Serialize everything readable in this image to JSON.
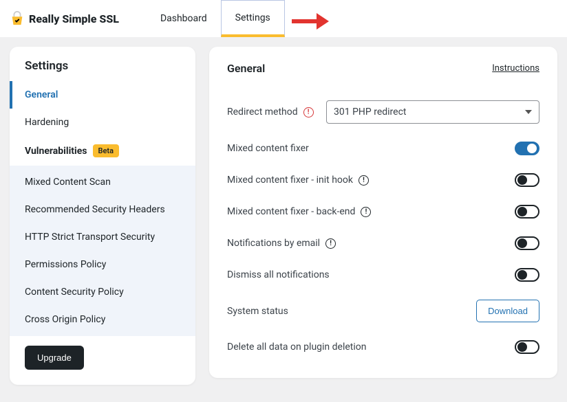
{
  "brand": "Really Simple SSL",
  "tabs": {
    "dashboard": "Dashboard",
    "settings": "Settings"
  },
  "sidebar": {
    "title": "Settings",
    "items": [
      {
        "label": "General"
      },
      {
        "label": "Hardening"
      },
      {
        "label": "Vulnerabilities",
        "badge": "Beta"
      },
      {
        "label": "Mixed Content Scan"
      },
      {
        "label": "Recommended Security Headers"
      },
      {
        "label": "HTTP Strict Transport Security"
      },
      {
        "label": "Permissions Policy"
      },
      {
        "label": "Content Security Policy"
      },
      {
        "label": "Cross Origin Policy"
      }
    ],
    "upgrade": "Upgrade"
  },
  "main": {
    "title": "General",
    "instructions": "Instructions",
    "rows": {
      "redirect": "Redirect method",
      "redirect_value": "301 PHP redirect",
      "mixed_fixer": "Mixed content fixer",
      "mixed_init": "Mixed content fixer - init hook",
      "mixed_back": "Mixed content fixer - back-end",
      "notify_email": "Notifications by email",
      "dismiss_all": "Dismiss all notifications",
      "system_status": "System status",
      "download": "Download",
      "delete_data": "Delete all data on plugin deletion"
    }
  }
}
